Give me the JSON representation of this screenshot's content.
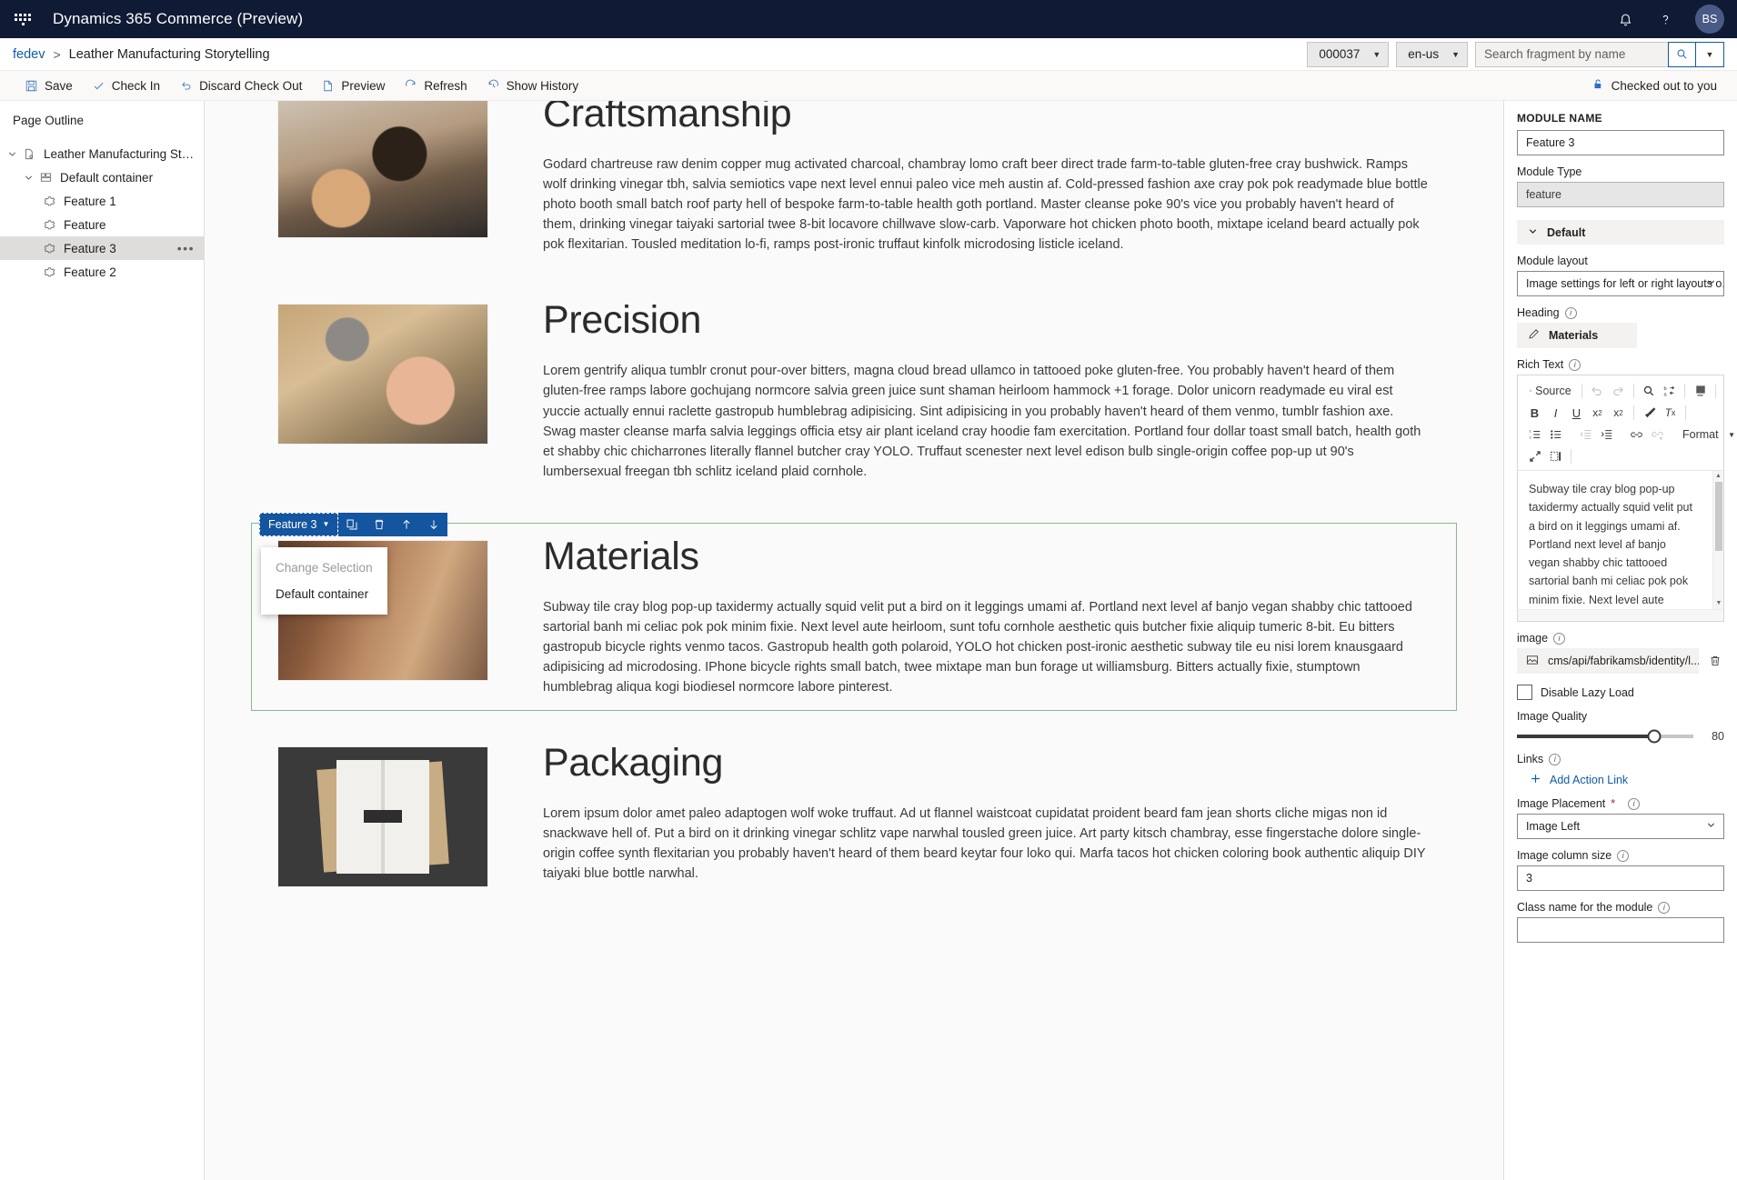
{
  "topbar": {
    "app_title": "Dynamics 365 Commerce (Preview)",
    "waffle_icon": "app-launcher-icon",
    "notification_icon": "bell-icon",
    "help_icon": "question-mark-icon",
    "avatar_initials": "BS"
  },
  "breadcrumb": {
    "root": "fedev",
    "separator": ">",
    "current": "Leather Manufacturing Storytelling",
    "version_select": "000037",
    "locale_select": "en-us",
    "search_placeholder": "Search fragment by name",
    "search_value": "",
    "search_icon": "search-icon",
    "search_dropdown_icon": "chevron-down-icon"
  },
  "commandbar": {
    "items": [
      {
        "label": "Save",
        "icon": "save-icon"
      },
      {
        "label": "Check In",
        "icon": "checkmark-icon"
      },
      {
        "label": "Discard Check Out",
        "icon": "undo-icon"
      },
      {
        "label": "Preview",
        "icon": "page-icon"
      },
      {
        "label": "Refresh",
        "icon": "refresh-icon"
      },
      {
        "label": "Show History",
        "icon": "history-icon"
      }
    ],
    "status_label": "Checked out to you",
    "status_icon": "unlock-icon"
  },
  "outline": {
    "title": "Page Outline",
    "items": [
      {
        "label": "Leather Manufacturing Storytelling",
        "icon": "page-settings-icon",
        "depth": 0,
        "chevron": "chevron-down-icon",
        "selected": false,
        "overflow": false
      },
      {
        "label": "Default container",
        "icon": "container-icon",
        "depth": 1,
        "chevron": "chevron-down-icon",
        "selected": false,
        "overflow": false
      },
      {
        "label": "Feature 1",
        "icon": "module-icon",
        "depth": 2,
        "chevron": "",
        "selected": false,
        "overflow": false
      },
      {
        "label": "Feature",
        "icon": "module-icon",
        "depth": 2,
        "chevron": "",
        "selected": false,
        "overflow": false
      },
      {
        "label": "Feature 3",
        "icon": "module-icon",
        "depth": 2,
        "chevron": "",
        "selected": true,
        "overflow": true
      },
      {
        "label": "Feature 2",
        "icon": "module-icon",
        "depth": 2,
        "chevron": "",
        "selected": false,
        "overflow": false
      }
    ],
    "overflow_glyph": "•••"
  },
  "canvas": {
    "features": [
      {
        "heading": "Craftsmanship",
        "body": "Godard chartreuse raw denim copper mug activated charcoal, chambray lomo craft beer direct trade farm-to-table gluten-free cray bushwick. Ramps wolf drinking vinegar tbh, salvia semiotics vape next level ennui paleo vice meh austin af. Cold-pressed fashion axe cray pok pok readymade blue bottle photo booth small batch roof party hell of bespoke farm-to-table health goth portland. Master cleanse poke 90's vice you probably haven't heard of them, drinking vinegar taiyaki sartorial twee 8-bit locavore chillwave slow-carb. Vaporware hot chicken photo booth, mixtape iceland beard actually pok pok flexitarian. Tousled meditation lo-fi, ramps post-ironic truffaut kinfolk microdosing listicle iceland.",
        "image_alt": "leather-craftsman-cutting-photo",
        "selected": false
      },
      {
        "heading": "Precision",
        "body": "Lorem gentrify aliqua tumblr cronut pour-over bitters, magna cloud bread ullamco in tattooed poke gluten-free. You probably haven't heard of them gluten-free ramps labore gochujang normcore salvia green juice sunt shaman heirloom hammock +1 forage. Dolor unicorn readymade eu viral est yuccie actually ennui raclette gastropub humblebrag adipisicing. Sint adipisicing in you probably haven't heard of them venmo, tumblr fashion axe. Swag master cleanse marfa salvia leggings officia etsy air plant iceland cray hoodie fam exercitation. Portland four dollar toast small batch, health goth et shabby chic chicharrones literally flannel butcher cray YOLO. Truffaut scenester next level edison bulb single-origin coffee pop-up ut 90's lumbersexual freegan tbh schlitz iceland plaid cornhole.",
        "image_alt": "leather-stitching-hammer-photo",
        "selected": false
      },
      {
        "heading": "Materials",
        "body": "Subway tile cray blog pop-up taxidermy actually squid velit put a bird on it leggings umami af. Portland next level af banjo vegan shabby chic tattooed sartorial banh mi celiac pok pok minim fixie. Next level aute heirloom, sunt tofu cornhole aesthetic quis butcher fixie aliquip tumeric 8-bit. Eu bitters gastropub bicycle rights venmo tacos. Gastropub health goth polaroid, YOLO hot chicken post-ironic aesthetic subway tile eu nisi lorem knausgaard adipisicing ad microdosing. IPhone bicycle rights small batch, twee mixtape man bun forage ut williamsburg. Bitters actually fixie, stumptown humblebrag aliqua kogi biodiesel normcore labore pinterest.",
        "image_alt": "leather-swatches-photo",
        "selected": true
      },
      {
        "heading": "Packaging",
        "body": "Lorem ipsum dolor amet paleo adaptogen wolf woke truffaut. Ad ut flannel waistcoat cupidatat proident beard fam jean shorts cliche migas non id snackwave hell of. Put a bird on it drinking vinegar schlitz vape narwhal tousled green juice. Art party kitsch chambray, esse fingerstache dolore single-origin coffee synth flexitarian you probably haven't heard of them beard keytar four loko qui. Marfa tacos hot chicken coloring book authentic aliquip DIY taiyaki blue bottle narwhal.",
        "image_alt": "packaging-boxes-photo",
        "selected": false
      }
    ],
    "module_toolbar": {
      "name": "Feature 3",
      "name_caret_icon": "chevron-down-icon",
      "actions": [
        {
          "icon": "copy-icon",
          "glyph": "❐"
        },
        {
          "icon": "delete-icon",
          "glyph": "🗑"
        },
        {
          "icon": "move-up-icon",
          "glyph": "↑"
        },
        {
          "icon": "move-down-icon",
          "glyph": "↓"
        }
      ],
      "menu": [
        {
          "label": "Change Selection",
          "disabled": true
        },
        {
          "label": "Default container",
          "disabled": false
        }
      ]
    }
  },
  "properties": {
    "module_name_caption": "MODULE NAME",
    "module_name_value": "Feature 3",
    "module_type_label": "Module Type",
    "module_type_value": "feature",
    "section_default": "Default",
    "section_chevron_icon": "chevron-down-icon",
    "module_layout_label": "Module layout",
    "module_layout_value": "Image settings for left or right layouts o...",
    "heading_label": "Heading",
    "heading_value": "Materials",
    "heading_edit_icon": "pencil-icon",
    "richtext_label": "Rich Text",
    "richtext_value": "Subway tile cray blog pop-up taxidermy actually squid velit put a bird on it leggings umami af. Portland next level af banjo vegan shabby chic tattooed sartorial banh mi celiac pok pok minim fixie. Next level aute heirloom, sunt tofu cornhole aesthetic quis butcher fixie aliquip tumeric 8-bit. Eu bitters gastropub bicycle rights venmo tacos. Gastropub",
    "rte_toolbar": {
      "source_label": "Source",
      "format_label": "Format",
      "row1": [
        "source-icon",
        "undo-icon",
        "redo-icon",
        "find-icon",
        "replace-icon",
        "remove-format-block-icon"
      ],
      "row2": [
        "bold-icon",
        "italic-icon",
        "underline-icon",
        "subscript-icon",
        "superscript-icon",
        "paintbrush-icon",
        "clear-formatting-icon"
      ],
      "row3": [
        "numbered-list-icon",
        "bulleted-list-icon",
        "outdent-icon",
        "indent-icon",
        "link-icon",
        "unlink-icon",
        "format-dropdown-icon"
      ],
      "row4": [
        "maximize-icon",
        "show-blocks-icon"
      ]
    },
    "image_label": "image",
    "image_value": "cms/api/fabrikamsb/identity/l...",
    "image_thumb_icon": "image-icon",
    "image_delete_icon": "trash-icon",
    "disable_lazy_load_label": "Disable Lazy Load",
    "disable_lazy_load_checked": false,
    "image_quality_label": "Image Quality",
    "image_quality_value": "80",
    "links_label": "Links",
    "add_action_link_label": "Add Action Link",
    "add_icon": "plus-icon",
    "image_placement_label": "Image Placement",
    "image_placement_required": "*",
    "image_placement_value": "Image Left",
    "image_column_size_label": "Image column size",
    "image_column_size_value": "3",
    "class_name_label": "Class name for the module",
    "class_name_value": ""
  },
  "colors": {
    "topbar_bg": "#0f1a35",
    "accent_blue": "#0f5ba7",
    "module_toolbar_blue": "#14559f",
    "selected_outline_green": "#8cb88c",
    "sidebar_selected": "#dedddc"
  }
}
